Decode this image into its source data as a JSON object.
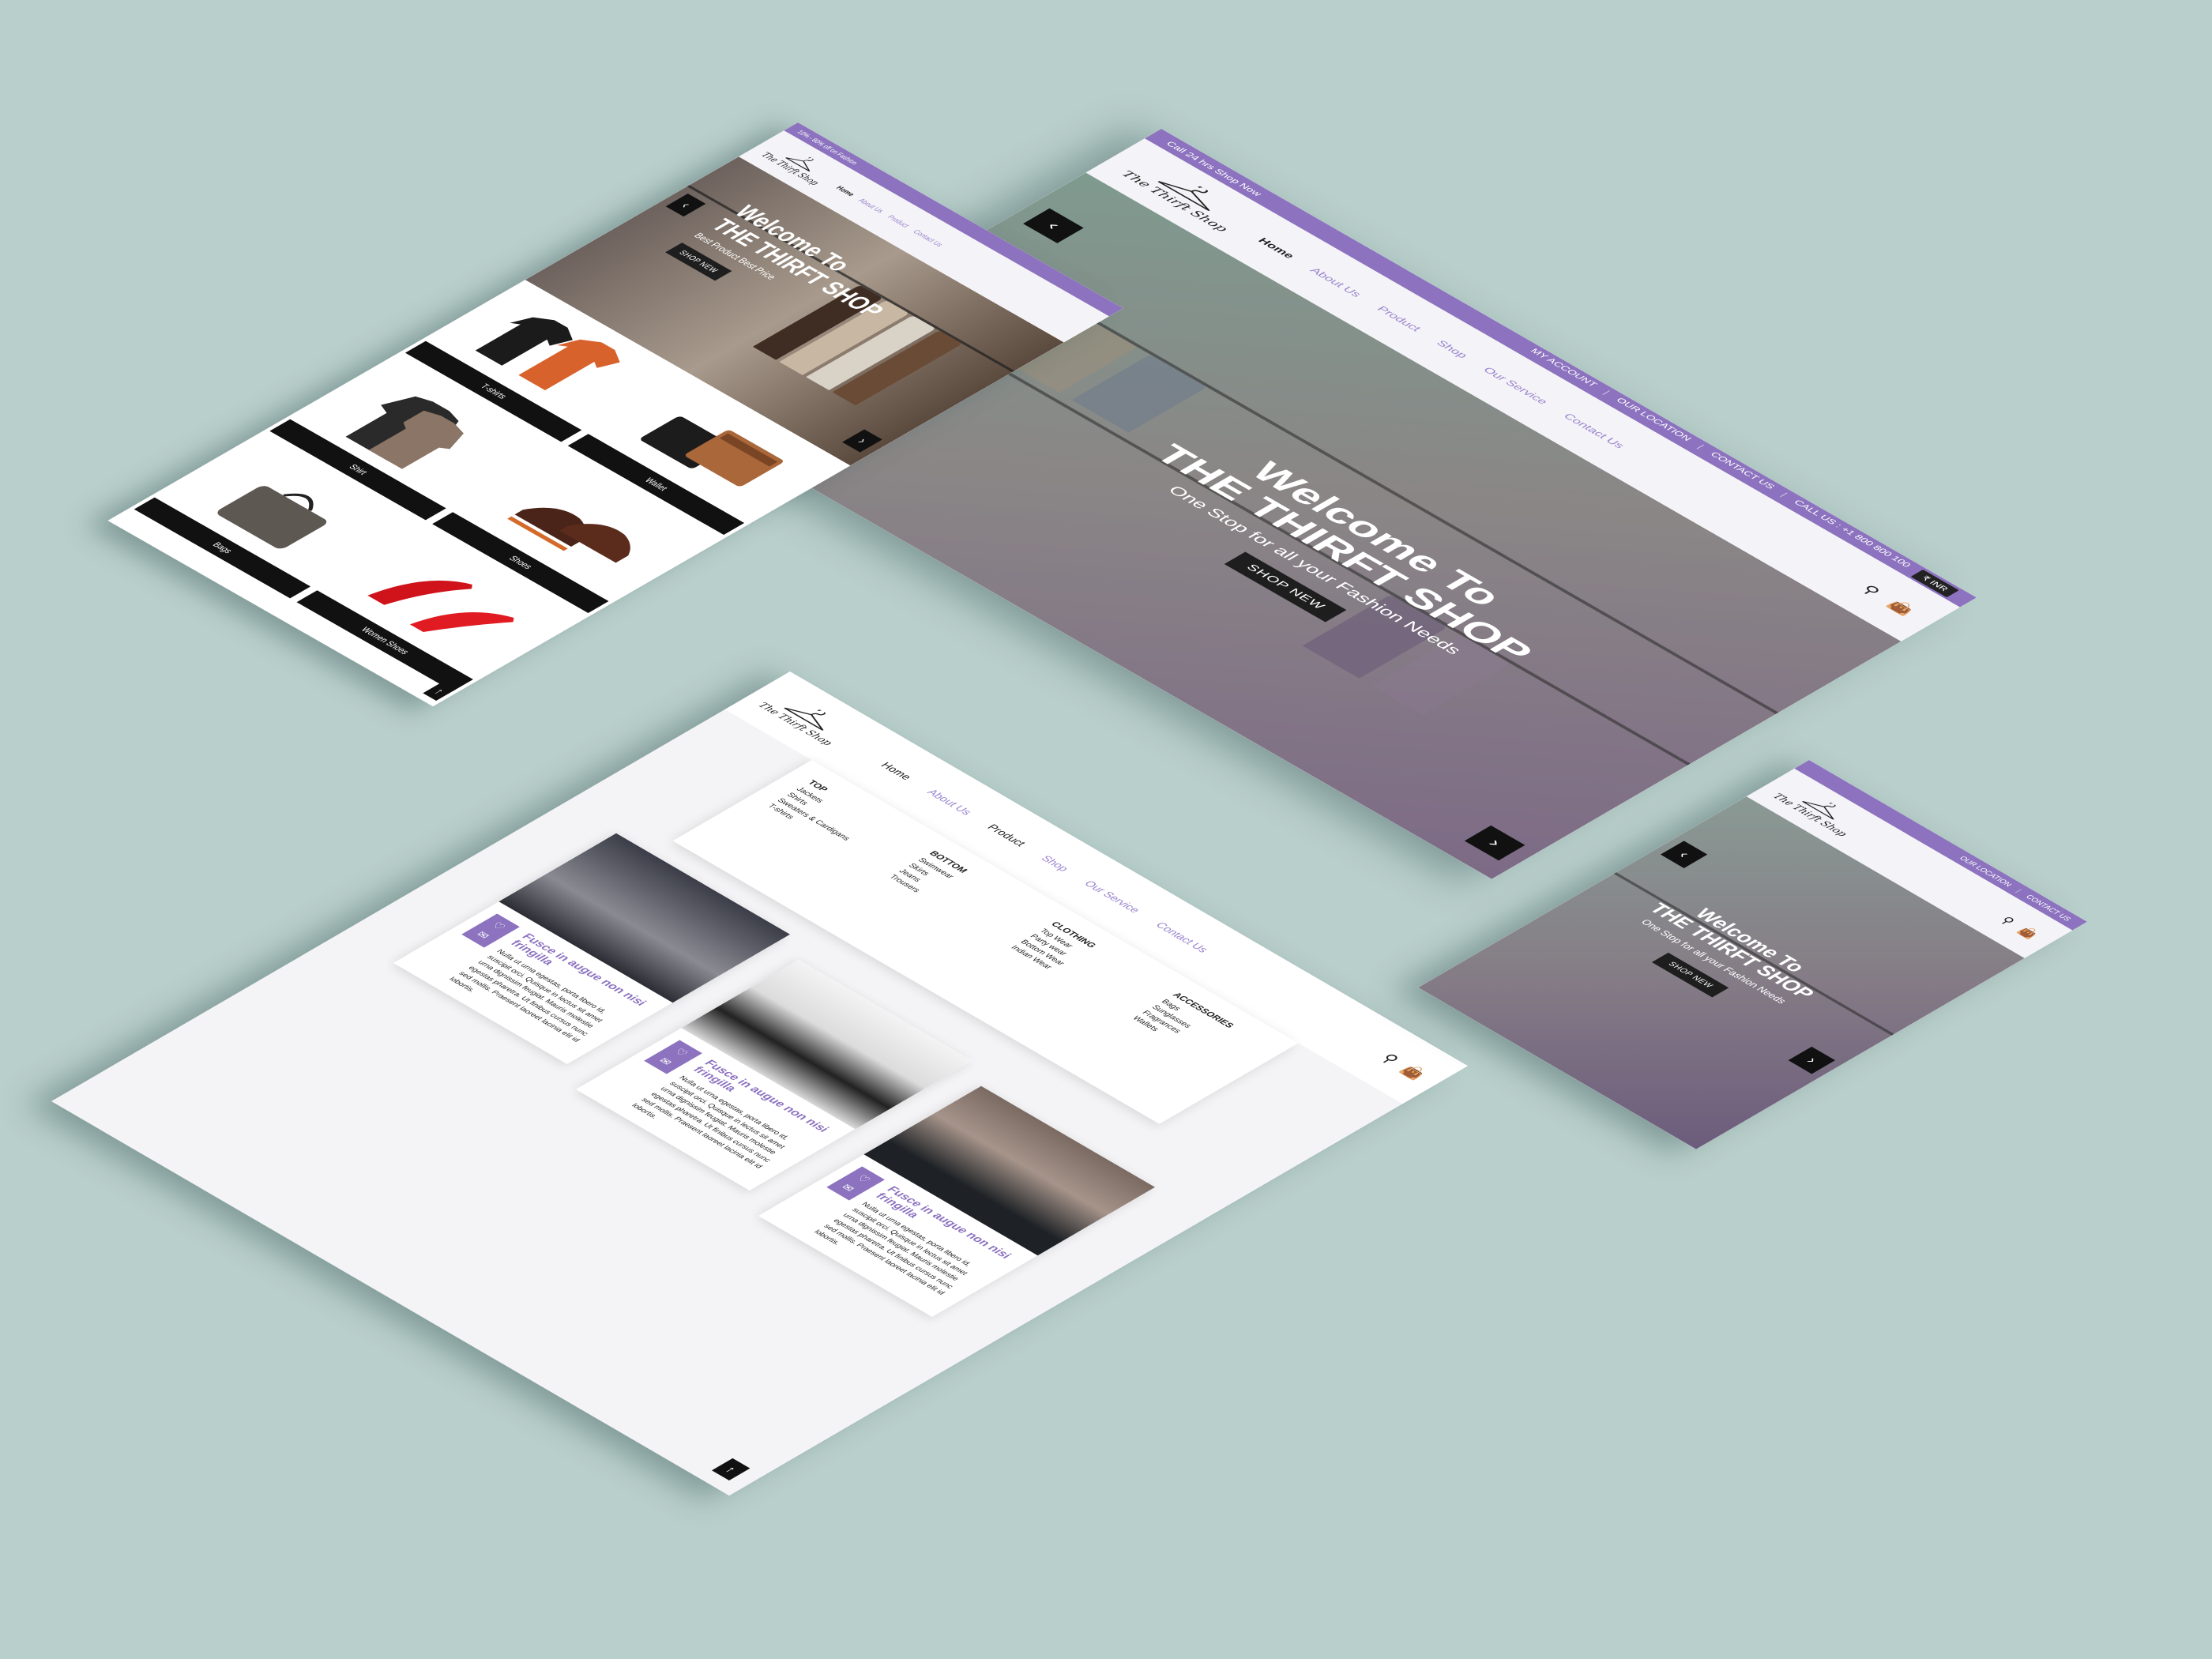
{
  "colors": {
    "accent": "#8c72bf",
    "dark": "#111111",
    "background": "#b9cfcb"
  },
  "brand": {
    "name": "The Thirft Shop"
  },
  "topbar_left_a": "10% - 80% off on Fashion",
  "topbar_left_b": "Call 24 hrs Shop Now",
  "topbar_links": [
    "MY ACCOUNT",
    "OUR LOCATION",
    "CONTACT US",
    "CALL US : +1 800 800 100"
  ],
  "currency": "₹ INR",
  "nav": [
    "Home",
    "About Us",
    "Product",
    "Shop",
    "Our Service",
    "Contact Us"
  ],
  "nav_short": [
    "Home",
    "About Us",
    "Product",
    "Contact Us"
  ],
  "hero_main": {
    "line1": "Welcome To",
    "line2": "THE THIRFT SHOP",
    "sub": "One Stop for all your Fashion Needs",
    "cta": "SHOP NEW"
  },
  "hero_small": {
    "line1": "Welcome To",
    "line2": "THE THIRFT SHOP",
    "sub": "Best Product Best Price",
    "cta": "SHOP NEW"
  },
  "categories": [
    "T-shirts",
    "Wallet",
    "Shirt",
    "Shoes",
    "Bags",
    "Women Shoes"
  ],
  "mega_menu": {
    "top": {
      "heading": "TOP",
      "items": [
        "Jackets",
        "Shirts",
        "Sweaters & Cardigans",
        "T-shirts"
      ]
    },
    "bottom": {
      "heading": "BOTTOM",
      "items": [
        "Swimwear",
        "Skirts",
        "Jeans",
        "Trousers"
      ]
    },
    "clothing": {
      "heading": "CLOTHING",
      "items": [
        "Top Wear",
        "Party wear",
        "Bottom Wear",
        "Indian Wear"
      ]
    },
    "accessories": {
      "heading": "ACCESSORIES",
      "items": [
        "Bags",
        "Sunglasses",
        "Fragrances",
        "Wallets"
      ]
    }
  },
  "cards": [
    {
      "title": "Fusce in augue non nisi fringilla",
      "text": "Nulla ut urna egestas, porta libero id, suscipit orci. Quisque in lectus sit amet urna dignissim feugiat. Mauris molestie egestas pharetra. Ut finibus cursus nunc sed mollis. Praesent laoreet lacinia elit id lobortis."
    },
    {
      "title": "Fusce in augue non nisi fringilla",
      "text": "Nulla ut urna egestas, porta libero id, suscipit orci. Quisque in lectus sit amet urna dignissim feugiat. Mauris molestie egestas pharetra. Ut finibus cursus nunc sed mollis. Praesent laoreet lacinia elit id lobortis."
    },
    {
      "title": "Fusce in augue non nisi fringilla",
      "text": "Nulla ut urna egestas, porta libero id, suscipit orci. Quisque in lectus sit amet urna dignissim feugiat. Mauris molestie egestas pharetra. Ut finibus cursus nunc sed mollis. Praesent laoreet lacinia elit id lobortis."
    }
  ],
  "contact_short": [
    "OUR LOCATION",
    "CONTACT US"
  ],
  "icons": {
    "prev": "chevron-left-icon",
    "next": "chevron-right-icon",
    "search": "search-icon",
    "cart": "cart-icon",
    "top": "arrow-up-icon"
  }
}
